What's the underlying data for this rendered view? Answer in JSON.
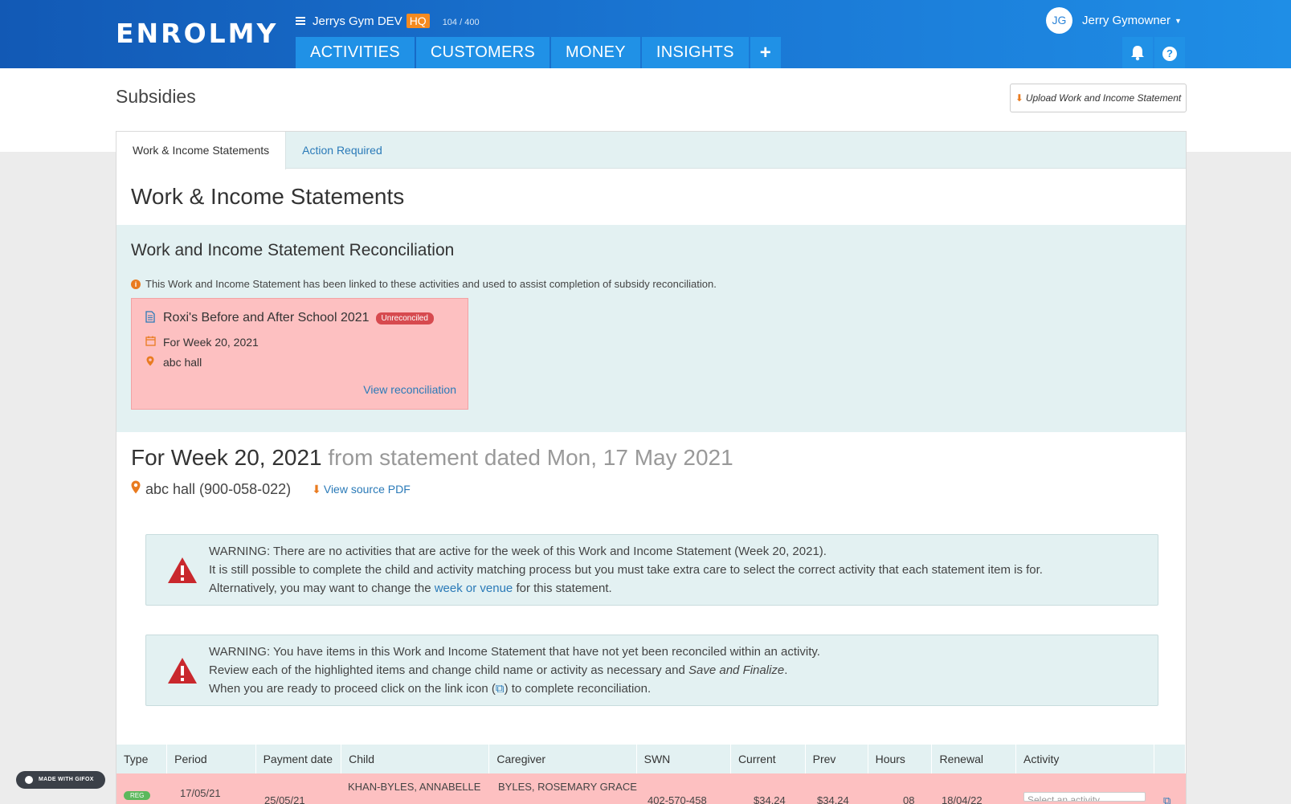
{
  "header": {
    "logo": "ENROLMY",
    "org_name": "Jerrys Gym DEV",
    "org_badge": "HQ",
    "count": "104 / 400",
    "nav": [
      "ACTIVITIES",
      "CUSTOMERS",
      "MONEY",
      "INSIGHTS"
    ],
    "nav_plus": "+",
    "user_initials": "JG",
    "user_name": "Jerry Gymowner"
  },
  "page": {
    "title": "Subsidies",
    "upload_button": "Upload Work and Income Statement"
  },
  "tabs": [
    "Work & Income Statements",
    "Action Required"
  ],
  "section_title": "Work & Income Statements",
  "reconciliation": {
    "heading": "Work and Income Statement Reconciliation",
    "info": "This Work and Income Statement has been linked to these activities and used to assist completion of subsidy reconciliation.",
    "card": {
      "activity": "Roxi's Before and After School 2021",
      "status": "Unreconciled",
      "week": "For Week 20, 2021",
      "venue": "abc hall",
      "link": "View reconciliation"
    }
  },
  "statement": {
    "week": "For Week 20, 2021",
    "dated": "from statement dated Mon, 17 May 2021",
    "venue": "abc hall (900-058-022)",
    "source_link": "View source PDF"
  },
  "warning1": {
    "line1": "WARNING: There are no activities that are active for the week of this Work and Income Statement (Week 20, 2021).",
    "line2": "It is still possible to complete the child and activity matching process but you must take extra care to select the correct activity that each statement item is for.",
    "line3_pre": "Alternatively, you may want to change the",
    "line3_link": "week or venue",
    "line3_post": "for this statement."
  },
  "warning2": {
    "line1": "WARNING: You have items in this Work and Income Statement that have not yet been reconciled within an activity.",
    "line2_pre": "Review each of the highlighted items and change child name or activity as necessary and",
    "line2_em": "Save and Finalize",
    "line2_post": ".",
    "line3_pre": "When you are ready to proceed click on the link icon (",
    "line3_post": ") to complete reconciliation."
  },
  "table": {
    "headers": [
      "Type",
      "Period",
      "Payment date",
      "Child",
      "Caregiver",
      "SWN",
      "Current",
      "Prev",
      "Hours",
      "Renewal",
      "Activity",
      ""
    ],
    "rows": [
      {
        "type": "REG",
        "period": "17/05/21",
        "payment_date": "25/05/21",
        "child": "KHAN-BYLES, ANNABELLE",
        "caregiver": "BYLES, ROSEMARY GRACE",
        "swn": "402-570-458",
        "current": "$34.24",
        "prev": "$34.24",
        "hours": "08",
        "renewal": "18/04/22",
        "activity_placeholder": "Select an activity"
      }
    ]
  },
  "watermark": "MADE WITH GIFOX",
  "colors": {
    "header_blue": "#1a77d4",
    "tab_blue": "#2091e6",
    "accent_orange": "#e97b20",
    "warning_red": "#c9282d",
    "unreconciled_bg": "#fdc0c1",
    "panel_teal": "#e3f1f2",
    "link_blue": "#2a7ab8"
  }
}
